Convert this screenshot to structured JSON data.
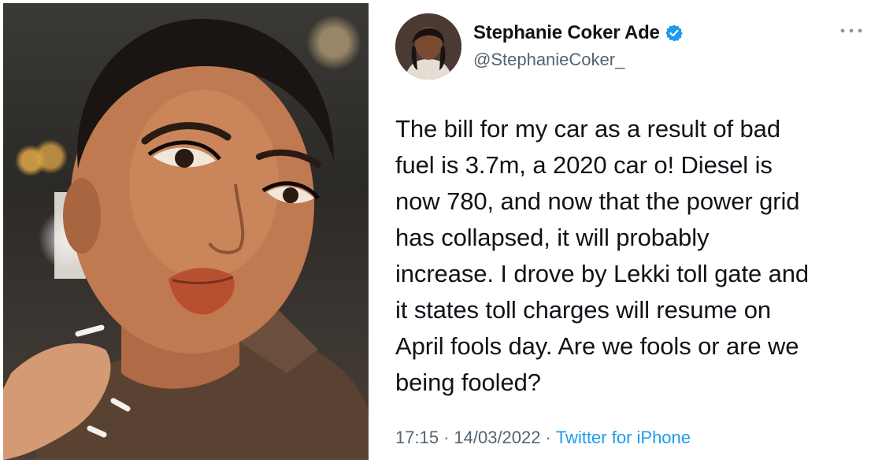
{
  "tweet": {
    "display_name": "Stephanie Coker Ade",
    "handle": "@StephanieCoker_",
    "verified": true,
    "body_lines": [
      "The bill for my car as a result of bad",
      "fuel is 3.7m, a 2020 car o! Diesel is",
      "now 780, and now that the power grid",
      "has collapsed, it will probably",
      "increase. I drove by Lekki toll gate and",
      "it states toll charges will resume on",
      "April fools day. Are we fools or are we",
      "being fooled?"
    ],
    "time": "17:15",
    "separator1": "·",
    "date": "14/03/2022",
    "separator2": "·",
    "source": "Twitter for iPhone"
  },
  "colors": {
    "verified_badge": "#1d9bf0",
    "link": "#1d9bf0",
    "secondary_text": "#536471",
    "primary_text": "#0f1419"
  }
}
